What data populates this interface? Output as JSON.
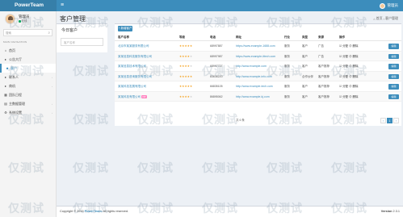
{
  "header": {
    "brand": "PowerTeam",
    "menu_icon": "≡",
    "user_name": "管理员"
  },
  "sidebar": {
    "user_name": "管理员",
    "status": "在线",
    "search_placeholder": "搜索",
    "search_icon": "search-icon",
    "nav_header": "MAIN NAVIGATION",
    "items": [
      {
        "label": "首页",
        "icon": "home-icon",
        "glyph": "⌂",
        "arrow": ""
      },
      {
        "label": "公告大厅",
        "icon": "megaphone-icon",
        "glyph": "▸",
        "arrow": ""
      },
      {
        "label": "客户",
        "icon": "users-icon",
        "glyph": "☻",
        "arrow": ""
      },
      {
        "label": "联系人",
        "icon": "contact-icon",
        "glyph": "▸",
        "arrow": "‹"
      },
      {
        "label": "商机",
        "icon": "briefcase-icon",
        "glyph": "▸",
        "arrow": "‹"
      },
      {
        "label": "团队日程",
        "icon": "calendar-icon",
        "glyph": "▦",
        "arrow": ""
      },
      {
        "label": "主数据管理",
        "icon": "database-icon",
        "glyph": "▤",
        "arrow": "‹"
      },
      {
        "label": "系统设置",
        "icon": "gear-icon",
        "glyph": "⚙",
        "arrow": "‹"
      }
    ]
  },
  "page": {
    "title": "客户管理",
    "breadcrumb_home": "首页",
    "breadcrumb_current": "客户管理"
  },
  "left_panel": {
    "title": "今日客户",
    "search_placeholder": "客户名称"
  },
  "table": {
    "new_button": "+ 新增客户",
    "columns": [
      "客户名称",
      "等级",
      "电话",
      "网址",
      "行业",
      "类型",
      "来源",
      "操作"
    ],
    "rows": [
      {
        "name": "北京市某某服务有限公司",
        "stars": 5,
        "vip": "",
        "phone": "68997887",
        "url": "https://www.example-1688.com",
        "industry": "服务",
        "type": "客户",
        "source": "广告",
        "ops": "☑ 分配 ⊘ 删除",
        "edit": "编辑"
      },
      {
        "name": "某某信息科技服务有限公司",
        "stars": 4,
        "vip": "",
        "phone": "68997987",
        "url": "https://www.example-ittech.com",
        "industry": "服务",
        "type": "客户",
        "source": "广告",
        "ops": "☑ 分配 ⊘ 删除",
        "edit": "编辑"
      },
      {
        "name": "某某信息技术有限公司",
        "stars": 4,
        "vip": "",
        "phone": "68997727",
        "url": "http://www.example.com",
        "industry": "服务",
        "type": "客户",
        "source": "客户推荐",
        "ops": "☑ 分配 ⊘ 删除",
        "edit": "编辑"
      },
      {
        "name": "某某信息咨询服务有限公司",
        "stars": 5,
        "vip": "",
        "phone": "83636220",
        "url": "http://www.example-info.com",
        "industry": "服务",
        "type": "合作伙伴",
        "source": "客户推荐",
        "ops": "☑ 分配 ⊘ 删除",
        "edit": "编辑"
      },
      {
        "name": "某某科技发展有限公司",
        "stars": 5,
        "vip": "",
        "phone": "66835105",
        "url": "http://www.example-tech.com",
        "industry": "服务",
        "type": "客户",
        "source": "客户推荐",
        "ops": "☑ 分配 ⊘ 删除",
        "edit": "编辑"
      },
      {
        "name": "某某科技有限公司",
        "stars": 4,
        "vip": "VIP",
        "phone": "86895062",
        "url": "http://www.example-kj.com",
        "industry": "服务",
        "type": "客户",
        "source": "客户推荐",
        "ops": "☑ 分配 ⊘ 删除",
        "edit": "编辑"
      }
    ],
    "total_text": "共 6 条",
    "pages": [
      "‹",
      "1",
      "›"
    ],
    "current_page": "1"
  },
  "footer": {
    "copyright_prefix": "Copyright © 2016",
    "copyright_brand": "PowerTeam.",
    "copyright_suffix": "All rights reserved.",
    "version_label": "Version",
    "version": "2.3.1"
  },
  "watermark": "仅测试",
  "colors": {
    "primary": "#3c8dbc",
    "header_dark": "#367fa9",
    "star": "#f39c12",
    "vip": "#ff85c0"
  }
}
